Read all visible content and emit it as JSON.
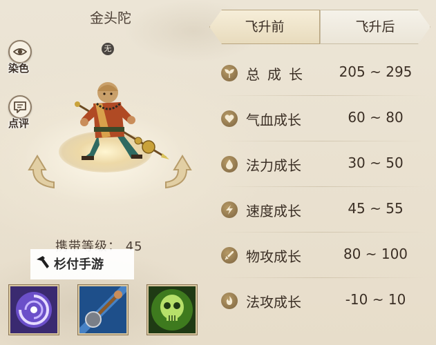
{
  "pet": {
    "name": "金头陀",
    "badge": "无",
    "carry_level": "携带等级： 45"
  },
  "side_buttons": {
    "dye": "染色",
    "review": "点评"
  },
  "watermark": "杉付手游",
  "tabs": {
    "before": "飞升前",
    "after": "飞升后"
  },
  "stats": [
    {
      "name": "总成长",
      "range": "205 ~ 295",
      "icon": "total-growth-icon"
    },
    {
      "name": "气血成长",
      "range": "60 ~ 80",
      "icon": "heart-icon"
    },
    {
      "name": "法力成长",
      "range": "30 ~ 50",
      "icon": "drop-icon"
    },
    {
      "name": "速度成长",
      "range": "45 ~ 55",
      "icon": "lightning-icon"
    },
    {
      "name": "物攻成长",
      "range": "80 ~ 100",
      "icon": "sword-icon"
    },
    {
      "name": "法攻成长",
      "range": "-10 ~ 10",
      "icon": "flame-icon"
    }
  ],
  "skills": [
    "vortex-skill-icon",
    "mace-skill-icon",
    "skull-skill-icon"
  ],
  "colors": {
    "background": "#e9e0cf",
    "text": "#3b2f25",
    "icon_gold": "#9b7f52"
  }
}
